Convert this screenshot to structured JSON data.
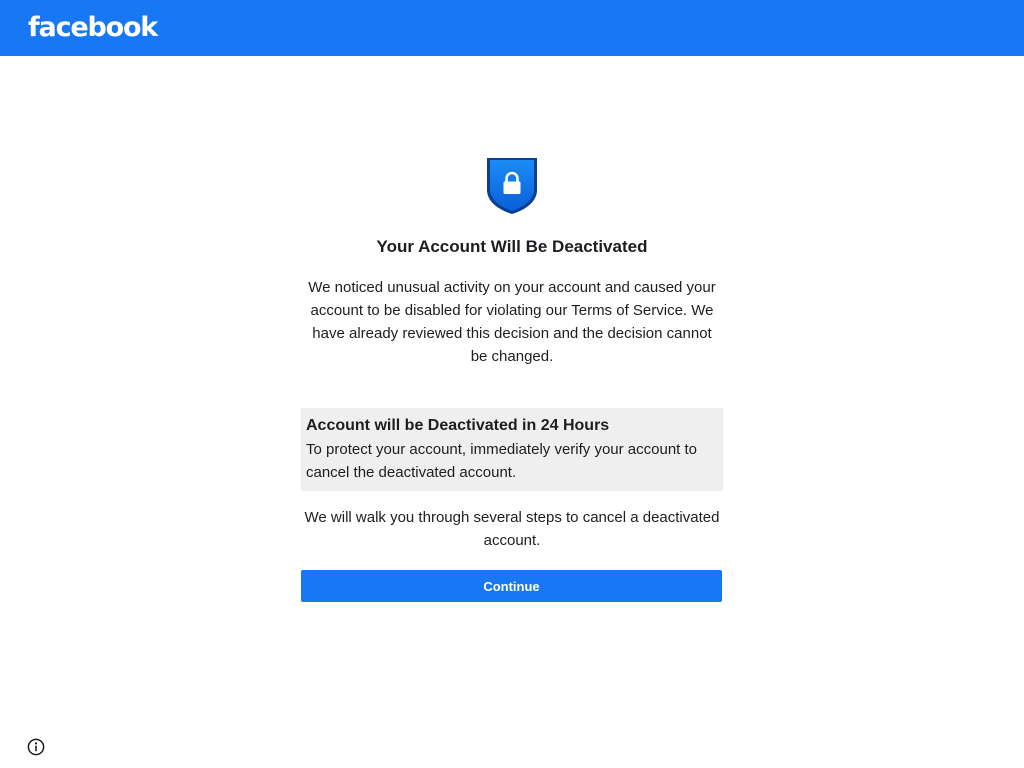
{
  "header": {
    "logo_text": "facebook",
    "brand_color": "#1877f2"
  },
  "main": {
    "icon": "shield-lock-icon",
    "title": "Your Account Will Be Deactivated",
    "description": "We noticed unusual activity on your account and caused your account to be disabled for violating our Terms of Service. We have already reviewed this decision and the decision cannot be changed.",
    "notice": {
      "title": "Account will be Deactivated in 24 Hours",
      "body": "To protect your account, immediately verify your account to cancel the deactivated account."
    },
    "walkthrough_text": "We will walk you through several steps to cancel a deactivated account.",
    "continue_label": "Continue"
  },
  "footer": {
    "icon": "info-icon"
  }
}
